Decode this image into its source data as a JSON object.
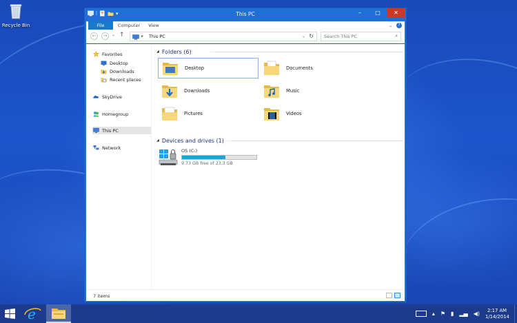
{
  "desktop": {
    "icons": [
      {
        "label": "Recycle Bin"
      }
    ]
  },
  "window": {
    "title": "This PC",
    "caption_buttons": {
      "minimize": "–",
      "maximize": "□",
      "close": "✕"
    },
    "ribbon_tabs": [
      "File",
      "Computer",
      "View"
    ],
    "address": {
      "crumb": "This PC",
      "separator": "▸",
      "dropdown": "⌄",
      "refresh": "↻"
    },
    "search": {
      "placeholder": "Search This PC"
    },
    "nav": {
      "back": "←",
      "forward": "→",
      "recent": "⌄",
      "up": "↑"
    },
    "navpane": {
      "favorites": {
        "label": "Favorites",
        "items": [
          "Desktop",
          "Downloads",
          "Recent places"
        ]
      },
      "skydrive": "SkyDrive",
      "homegroup": "Homegroup",
      "thispc": "This PC",
      "network": "Network"
    },
    "folders_group": {
      "label": "Folders (6)"
    },
    "folders": [
      {
        "name": "Desktop",
        "icon": "desktop-folder-icon"
      },
      {
        "name": "Documents",
        "icon": "documents-folder-icon"
      },
      {
        "name": "Downloads",
        "icon": "downloads-folder-icon"
      },
      {
        "name": "Music",
        "icon": "music-folder-icon"
      },
      {
        "name": "Pictures",
        "icon": "pictures-folder-icon"
      },
      {
        "name": "Videos",
        "icon": "videos-folder-icon"
      }
    ],
    "devices_group": {
      "label": "Devices and drives (1)"
    },
    "drives": [
      {
        "name": "OS (C:)",
        "free": "9.73 GB free of 23.3 GB",
        "used_fraction": 0.58
      }
    ],
    "status": {
      "item_count": "7 items"
    }
  },
  "taskbar": {
    "time": "2:17 AM",
    "date": "1/14/2014",
    "tray_icons": [
      "keyboard-icon",
      "flag-icon",
      "power-icon",
      "network-icon",
      "volume-icon"
    ]
  },
  "colors": {
    "accent": "#1979ca",
    "titlebar": "#1f6fd6",
    "close": "#c7392b",
    "progress": "#26a0da",
    "taskbar": "#1c3b8c"
  }
}
